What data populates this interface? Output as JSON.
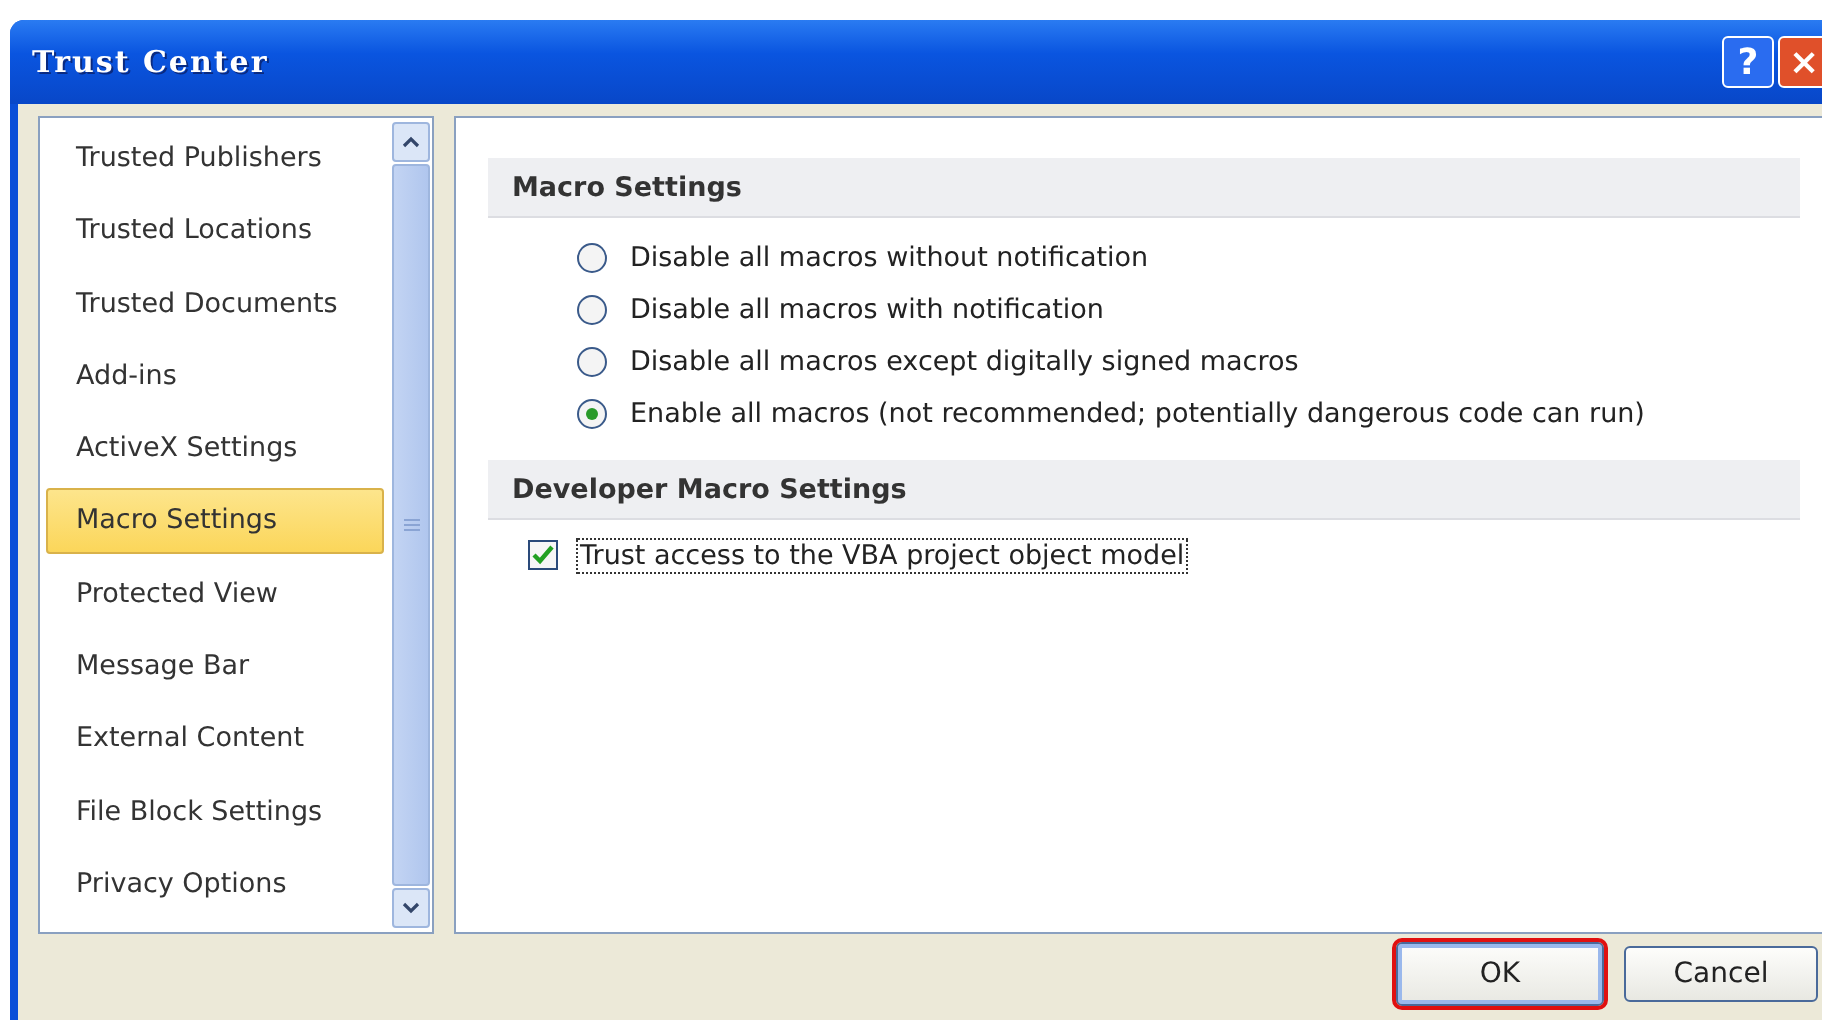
{
  "window": {
    "title": "Trust Center",
    "help_button": "?",
    "close_button": "×"
  },
  "sidebar": {
    "items": [
      {
        "label": "Trusted Publishers",
        "selected": false
      },
      {
        "label": "Trusted Locations",
        "selected": false
      },
      {
        "label": "Trusted Documents",
        "selected": false
      },
      {
        "label": "Add-ins",
        "selected": false
      },
      {
        "label": "ActiveX Settings",
        "selected": false
      },
      {
        "label": "Macro Settings",
        "selected": true
      },
      {
        "label": "Protected View",
        "selected": false
      },
      {
        "label": "Message Bar",
        "selected": false
      },
      {
        "label": "External Content",
        "selected": false
      },
      {
        "label": "File Block Settings",
        "selected": false
      },
      {
        "label": "Privacy Options",
        "selected": false
      }
    ]
  },
  "sections": [
    {
      "title": "Macro Settings",
      "kind": "radio",
      "options": [
        {
          "label": "Disable all macros without notification",
          "selected": false
        },
        {
          "label": "Disable all macros with notification",
          "selected": false
        },
        {
          "label": "Disable all macros except digitally signed macros",
          "selected": false
        },
        {
          "label": "Enable all macros (not recommended; potentially dangerous code can run)",
          "selected": true
        }
      ]
    },
    {
      "title": "Developer Macro Settings",
      "kind": "checkbox",
      "options": [
        {
          "label": "Trust access to the VBA project object model",
          "checked": true,
          "focused": true
        }
      ]
    }
  ],
  "buttons": [
    {
      "label": "OK",
      "highlighted": true
    },
    {
      "label": "Cancel",
      "highlighted": false
    }
  ]
}
